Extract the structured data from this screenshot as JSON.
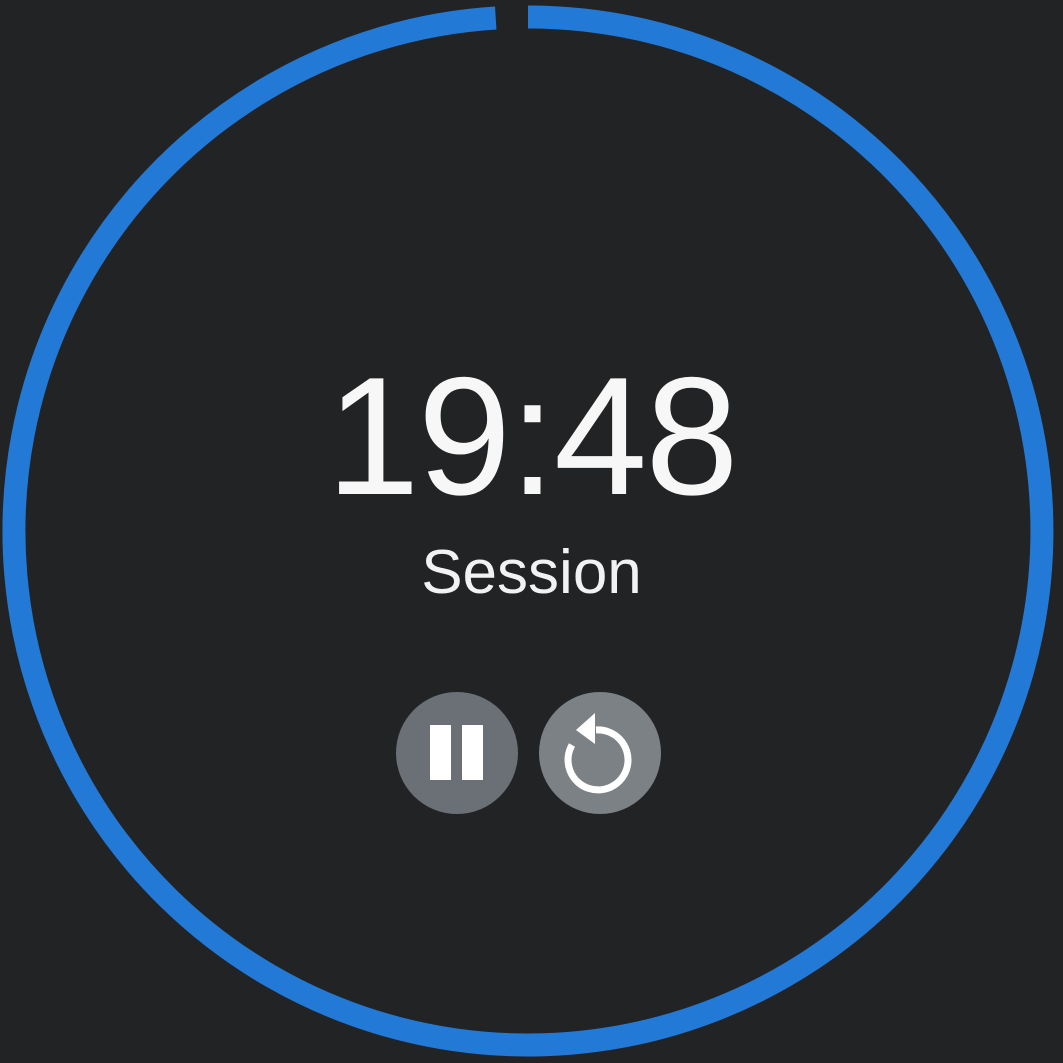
{
  "timer": {
    "time": "19:48",
    "label": "Session",
    "progress_fraction": 0.99
  },
  "controls": {
    "pause_icon": "pause-icon",
    "reset_icon": "reset-icon"
  },
  "colors": {
    "background": "#222325",
    "ring": "#2279d6",
    "pause_button": "#6b7077",
    "reset_button": "#7c8186",
    "text": "#f5f5f5"
  }
}
